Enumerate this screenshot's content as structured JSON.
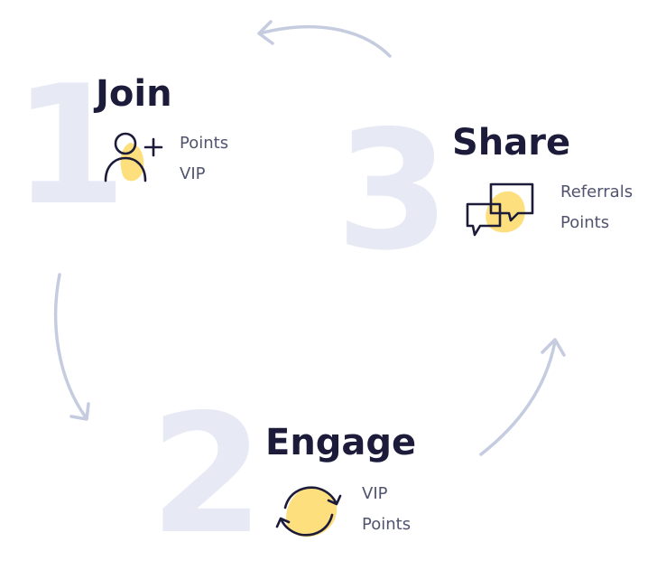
{
  "steps": [
    {
      "number": "1",
      "title": "Join",
      "icon": "user-plus-icon",
      "items": [
        "Points",
        "VIP"
      ]
    },
    {
      "number": "2",
      "title": "Engage",
      "icon": "refresh-cycle-icon",
      "items": [
        "VIP",
        "Points"
      ]
    },
    {
      "number": "3",
      "title": "Share",
      "icon": "chat-bubbles-icon",
      "items": [
        "Referrals",
        "Points"
      ]
    }
  ],
  "colors": {
    "number_fill": "#e7eaf5",
    "title": "#1c1c3a",
    "item_text": "#50546e",
    "icon_stroke": "#1c1c3a",
    "icon_blob": "#fddf7e",
    "arrow": "#c5ccdf"
  }
}
